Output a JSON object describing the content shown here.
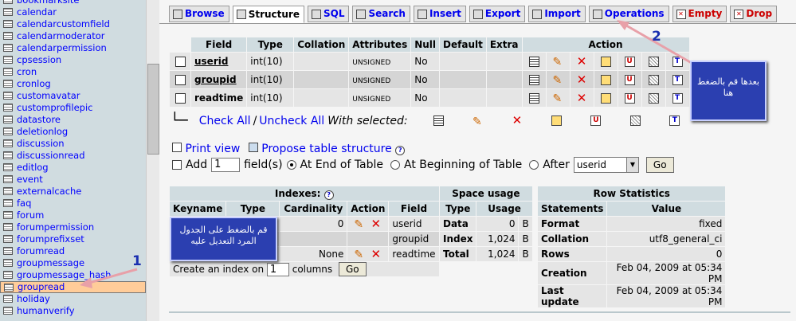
{
  "sidebar": {
    "tables": [
      "bookmarksite",
      "calendar",
      "calendarcustomfield",
      "calendarmoderator",
      "calendarpermission",
      "cpsession",
      "cron",
      "cronlog",
      "customavatar",
      "customprofilepic",
      "datastore",
      "deletionlog",
      "discussion",
      "discussionread",
      "editlog",
      "event",
      "externalcache",
      "faq",
      "forum",
      "forumpermission",
      "forumprefixset",
      "forumread",
      "groupmessage",
      "groupmessage_hash",
      "groupread",
      "holiday",
      "humanverify"
    ],
    "selected": "groupread"
  },
  "tabs": [
    {
      "label": "Browse",
      "icon": "browse-icon"
    },
    {
      "label": "Structure",
      "icon": "structure-icon",
      "active": true
    },
    {
      "label": "SQL",
      "icon": "sql-icon"
    },
    {
      "label": "Search",
      "icon": "search-icon"
    },
    {
      "label": "Insert",
      "icon": "insert-icon"
    },
    {
      "label": "Export",
      "icon": "export-icon"
    },
    {
      "label": "Import",
      "icon": "import-icon"
    },
    {
      "label": "Operations",
      "icon": "operations-icon"
    },
    {
      "label": "Empty",
      "icon": "empty-icon",
      "danger": true
    },
    {
      "label": "Drop",
      "icon": "drop-icon",
      "danger": true
    }
  ],
  "fields_table": {
    "headers": {
      "field": "Field",
      "type": "Type",
      "collation": "Collation",
      "attributes": "Attributes",
      "null": "Null",
      "default": "Default",
      "extra": "Extra",
      "action": "Action"
    },
    "rows": [
      {
        "field": "userid",
        "type": "int(10)",
        "collation": "",
        "attributes": "UNSIGNED",
        "null": "No",
        "default": "",
        "extra": ""
      },
      {
        "field": "groupid",
        "type": "int(10)",
        "collation": "",
        "attributes": "UNSIGNED",
        "null": "No",
        "default": "",
        "extra": ""
      },
      {
        "field": "readtime",
        "type": "int(10)",
        "collation": "",
        "attributes": "UNSIGNED",
        "null": "No",
        "default": "",
        "extra": ""
      }
    ]
  },
  "check_all": "Check All",
  "separator": "/",
  "uncheck_all": "Uncheck All",
  "with_selected": "With selected:",
  "print_view": "Print view",
  "propose_structure": "Propose table structure",
  "add_row": {
    "add_label": "Add",
    "count": "1",
    "fields_label": "field(s)",
    "end_label": "At End of Table",
    "begin_label": "At Beginning of Table",
    "after_label": "After",
    "after_field": "userid",
    "go": "Go"
  },
  "indexes": {
    "title": "Indexes:",
    "headers": {
      "keyname": "Keyname",
      "type": "Type",
      "cardinality": "Cardinality",
      "action": "Action",
      "field": "Field"
    },
    "rows": [
      {
        "keyname": "",
        "type": "",
        "cardinality": "0",
        "field": "userid"
      },
      {
        "keyname": "",
        "type": "",
        "cardinality": "",
        "field": "groupid"
      },
      {
        "keyname": "",
        "type": "",
        "cardinality": "None",
        "field": "readtime"
      }
    ],
    "create_label": "Create an index on",
    "create_count": "1",
    "columns_label": "columns",
    "go": "Go"
  },
  "space_usage": {
    "title": "Space usage",
    "headers": {
      "type": "Type",
      "usage": "Usage"
    },
    "rows": [
      {
        "type": "Data",
        "value": "0",
        "unit": "B"
      },
      {
        "type": "Index",
        "value": "1,024",
        "unit": "B"
      },
      {
        "type": "Total",
        "value": "1,024",
        "unit": "B"
      }
    ]
  },
  "row_statistics": {
    "title": "Row Statistics",
    "headers": {
      "statements": "Statements",
      "value": "Value"
    },
    "rows": [
      {
        "label": "Format",
        "value": "fixed"
      },
      {
        "label": "Collation",
        "value": "utf8_general_ci"
      },
      {
        "label": "Rows",
        "value": "0"
      },
      {
        "label": "Creation",
        "value": "Feb 04, 2009 at 05:34 PM"
      },
      {
        "label": "Last update",
        "value": "Feb 04, 2009 at 05:34 PM"
      }
    ]
  },
  "annotations": {
    "step1_number": "1",
    "step1_text": "قم بالضغط على الجدول المرد التعديل عليه",
    "step2_number": "2",
    "step2_text": "بعدها قم بالضغط هنا",
    "arrow_color": "#e8a0a8"
  }
}
